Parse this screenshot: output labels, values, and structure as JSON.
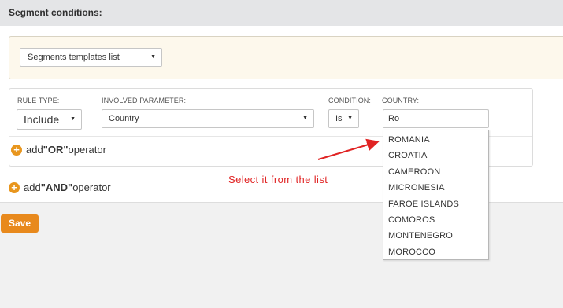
{
  "panel": {
    "title": "Segment conditions:",
    "templates_select": "Segments templates list"
  },
  "rule": {
    "rule_type": {
      "label": "RULE TYPE:",
      "value": "Include"
    },
    "involved_parameter": {
      "label": "INVOLVED PARAMETER:",
      "value": "Country"
    },
    "condition": {
      "label": "CONDITION:",
      "value": "Is"
    },
    "country": {
      "label": "COUNTRY:",
      "value": "Ro"
    },
    "add_or": {
      "prefix": "add ",
      "keyword": "\"OR\"",
      "suffix": " operator"
    }
  },
  "add_and": {
    "prefix": "add ",
    "keyword": "\"AND\"",
    "suffix": " operator"
  },
  "dropdown": {
    "options": [
      "ROMANIA",
      "CROATIA",
      "CAMEROON",
      "MICRONESIA",
      "FAROE ISLANDS",
      "COMOROS",
      "MONTENEGRO",
      "MOROCCO"
    ]
  },
  "annotation": {
    "text": "Select it from the list",
    "color": "#e02424"
  },
  "actions": {
    "save_label": "Save"
  },
  "colors": {
    "accent": "#e8891c",
    "header_bg": "#e4e5e7",
    "templates_bg": "#fdf8ec"
  }
}
